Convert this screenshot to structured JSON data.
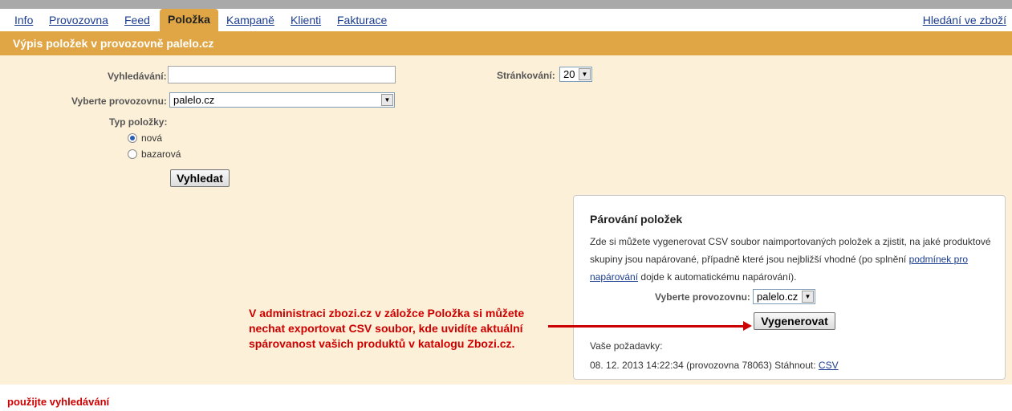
{
  "nav": {
    "tabs": [
      "Info",
      "Provozovna",
      "Feed",
      "Položka",
      "Kampaně",
      "Klienti",
      "Fakturace"
    ],
    "active_tab": "Položka",
    "right_link": "Hledání ve zboží"
  },
  "header": {
    "title": "Výpis položek v provozovně palelo.cz"
  },
  "search_form": {
    "search_label": "Vyhledávání:",
    "search_value": "",
    "paging_label": "Stránkování:",
    "paging_value": "20",
    "shop_label": "Vyberte provozovnu:",
    "shop_value": "palelo.cz",
    "type_label": "Typ položky:",
    "type_options": [
      "nová",
      "bazarová"
    ],
    "type_selected": "nová",
    "submit_label": "Vyhledat"
  },
  "pairing_panel": {
    "title": "Párování položek",
    "desc_part1": "Zde si můžete vygenerovat CSV soubor naimportovaných položek a zjistit, na jaké produktové skupiny jsou napárované, případně které jsou nejbližší vhodné (po splnění",
    "desc_link": "podmínek pro napárování",
    "desc_part2": "dojde k automatickému napárování).",
    "shop_label": "Vyberte provozovnu:",
    "shop_value": "palelo.cz",
    "generate_label": "Vygenerovat",
    "requests_label": "Vaše požadavky:",
    "request_text": "08. 12. 2013 14:22:34 (provozovna 78063) Stáhnout:",
    "request_link": "CSV"
  },
  "annotation": {
    "text": "V administraci zbozi.cz v záložce Položka si můžete nechat exportovat CSV soubor, kde uvidíte aktuální spárovanost vašich produktů v katalogu Zbozi.cz.",
    "color": "#cc0000"
  },
  "footer_hint": "použijte vyhledávání",
  "colors": {
    "accent": "#e0a646",
    "panel_bg": "#fdf0d8",
    "link": "#1a3c8e",
    "annotation": "#cc0000"
  }
}
